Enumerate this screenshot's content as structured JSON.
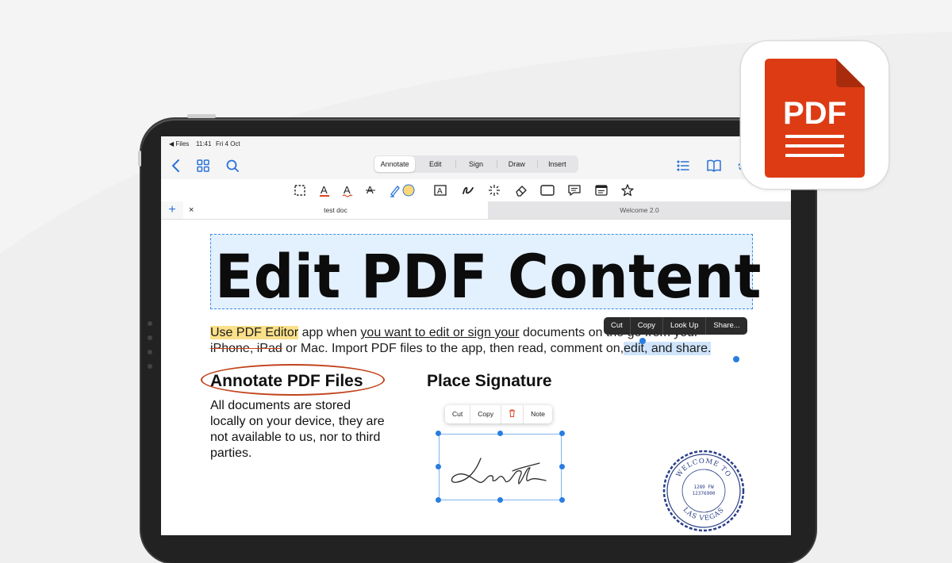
{
  "colors": {
    "brand": "#e0461e",
    "accent": "#2a72d8",
    "heading_bg": "#e3f0fd"
  },
  "status": {
    "back": "◀ Files",
    "time": "11:41",
    "date": "Fri 4 Oct"
  },
  "nav": {
    "modes": [
      "Annotate",
      "Edit",
      "Sign",
      "Draw",
      "Insert"
    ],
    "active_mode": "Annotate",
    "icons": [
      "back-icon",
      "grid-icon",
      "search-icon",
      "list-icon",
      "book-icon",
      "gear-icon"
    ]
  },
  "toolbar": {
    "tools": [
      "select-icon",
      "text-color-icon",
      "text-underline-icon",
      "text-icon",
      "highlighter-icon",
      "textbox-icon",
      "freehand-icon",
      "magic-icon",
      "eraser-icon",
      "rectangle-icon",
      "comment-icon",
      "window-icon",
      "star-icon"
    ],
    "text_glyph": "A"
  },
  "tabs": [
    {
      "label": "test doc",
      "active": true
    },
    {
      "label": "Welcome 2.0",
      "active": false
    }
  ],
  "tab_add": "+",
  "tab_close": "×",
  "document": {
    "title": "Edit PDF Content",
    "para_line1": {
      "highlight": "Use PDF Editor",
      "t1": " app when ",
      "underline": "you want to edit or sign your",
      "t2": " documents on the go from your"
    },
    "para_line2": {
      "strike": "iPhone, iPad",
      "t1": " or Mac. Import PDF files to the app, then read, comment on,",
      "selected": "edit, and share."
    },
    "copy_menu": [
      "Cut",
      "Copy",
      "Look Up",
      "Share..."
    ],
    "subheading_left": "Annotate PDF Files",
    "body_left": "All documents are stored locally on your device, they are not available to us, nor to third parties.",
    "subheading_right": "Place Signature",
    "signature_menu": [
      "Cut",
      "Copy",
      "Note"
    ],
    "stamp": {
      "top_text": "WELCOME TO",
      "line1": "1289 FW",
      "line2": "12376900",
      "bottom_text": "LAS VEGAS"
    }
  },
  "app_icon": {
    "label": "PDF"
  }
}
